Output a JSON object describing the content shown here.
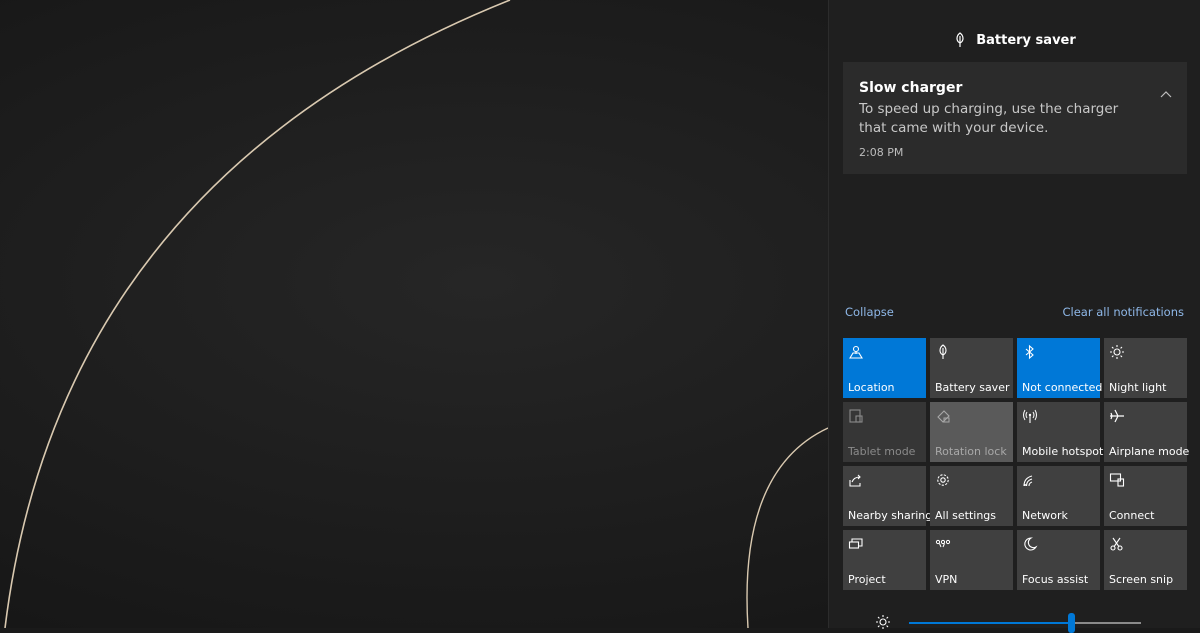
{
  "group": {
    "title": "Battery saver",
    "icon": "battery-saver-icon"
  },
  "notification": {
    "title": "Slow charger",
    "body": "To speed up charging, use the charger that came with your device.",
    "time": "2:08 PM"
  },
  "actions": {
    "collapse": "Collapse",
    "clear_all": "Clear all notifications"
  },
  "tiles": [
    {
      "label": "Location",
      "icon": "location-icon",
      "state": "active"
    },
    {
      "label": "Battery saver",
      "icon": "battery-saver-icon",
      "state": "off"
    },
    {
      "label": "Not connected",
      "icon": "bluetooth-icon",
      "state": "active"
    },
    {
      "label": "Night light",
      "icon": "night-light-icon",
      "state": "off"
    },
    {
      "label": "Tablet mode",
      "icon": "tablet-mode-icon",
      "state": "disabled"
    },
    {
      "label": "Rotation lock",
      "icon": "rotation-lock-icon",
      "state": "disabled"
    },
    {
      "label": "Mobile hotspot",
      "icon": "mobile-hotspot-icon",
      "state": "off"
    },
    {
      "label": "Airplane mode",
      "icon": "airplane-icon",
      "state": "off"
    },
    {
      "label": "Nearby sharing",
      "icon": "nearby-sharing-icon",
      "state": "off"
    },
    {
      "label": "All settings",
      "icon": "gear-icon",
      "state": "off"
    },
    {
      "label": "Network",
      "icon": "network-icon",
      "state": "off"
    },
    {
      "label": "Connect",
      "icon": "connect-icon",
      "state": "off"
    },
    {
      "label": "Project",
      "icon": "project-icon",
      "state": "off"
    },
    {
      "label": "VPN",
      "icon": "vpn-icon",
      "state": "off"
    },
    {
      "label": "Focus assist",
      "icon": "moon-icon",
      "state": "off"
    },
    {
      "label": "Screen snip",
      "icon": "screen-snip-icon",
      "state": "off"
    }
  ],
  "brightness": {
    "level": 0.7,
    "icon": "sun-icon"
  },
  "colors": {
    "accent": "#0078d7",
    "panel": "#1f1f1f",
    "tile": "#404040",
    "link": "#8fb8e8"
  }
}
